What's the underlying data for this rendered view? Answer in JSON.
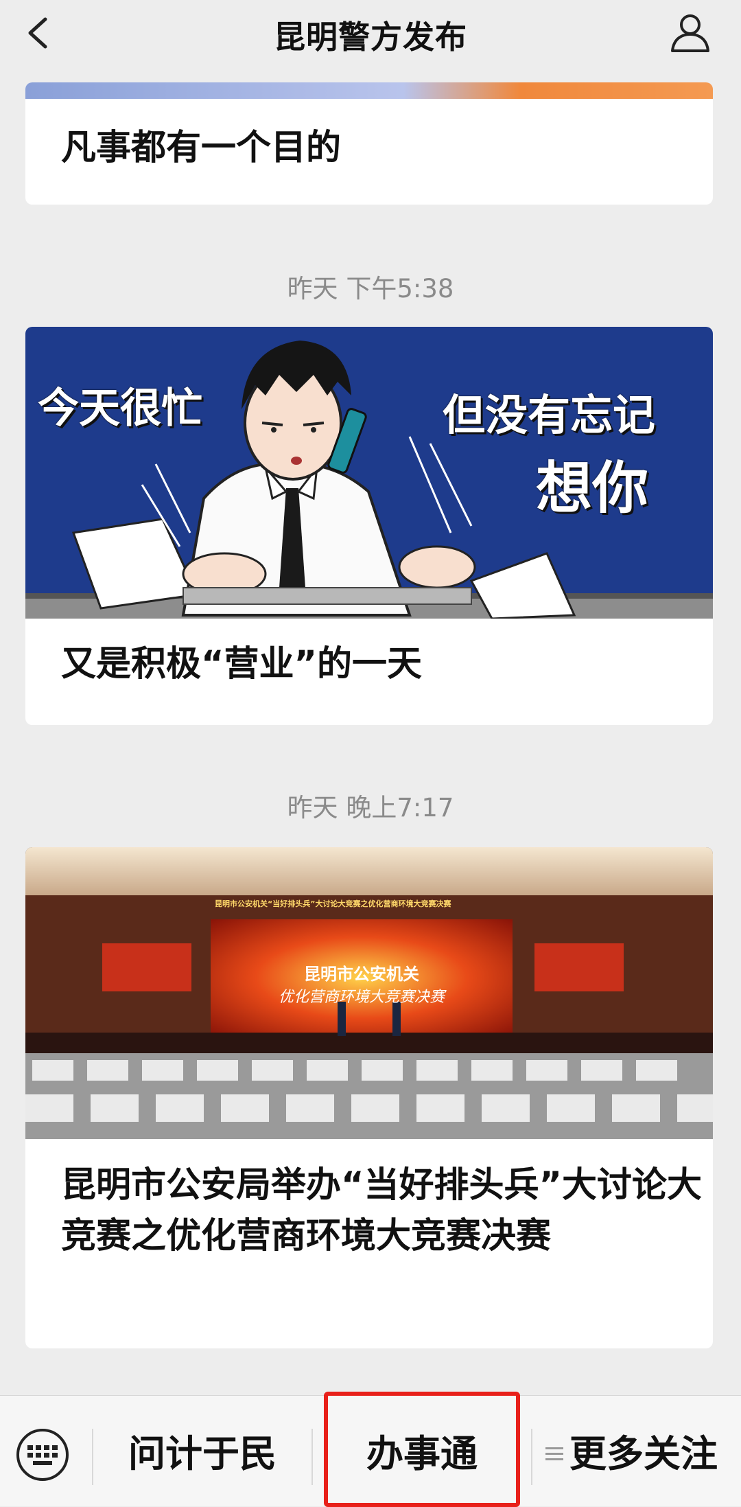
{
  "header": {
    "title": "昆明警方发布",
    "back_icon": "chevron-left-icon",
    "profile_icon": "user-profile-icon"
  },
  "feed": [
    {
      "title": "凡事都有一个目的"
    },
    {
      "timestamp": "昨天 下午5:38",
      "image_text": {
        "left": "今天很忙",
        "right_top": "但没有忘记",
        "right_bottom": "想你"
      },
      "title": "又是积极“营业”的一天"
    },
    {
      "timestamp": "昨天 晚上7:17",
      "image_text": {
        "banner": "昆明市公安机关“当好排头兵”大讨论大竞赛之优化营商环境大竞赛决赛",
        "screen_line1": "昆明市公安机关",
        "screen_line2": "优化营商环境大竞赛决赛"
      },
      "title": "昆明市公安局举办“当好排头兵”大讨论大竞赛之优化营商环境大竞赛决赛"
    }
  ],
  "bottom_menu": {
    "keyboard_icon": "keyboard-icon",
    "items": [
      "问计于民",
      "办事通",
      "更多关注"
    ],
    "more_icon": "menu-lines-icon",
    "highlight_color": "#e8201a"
  }
}
